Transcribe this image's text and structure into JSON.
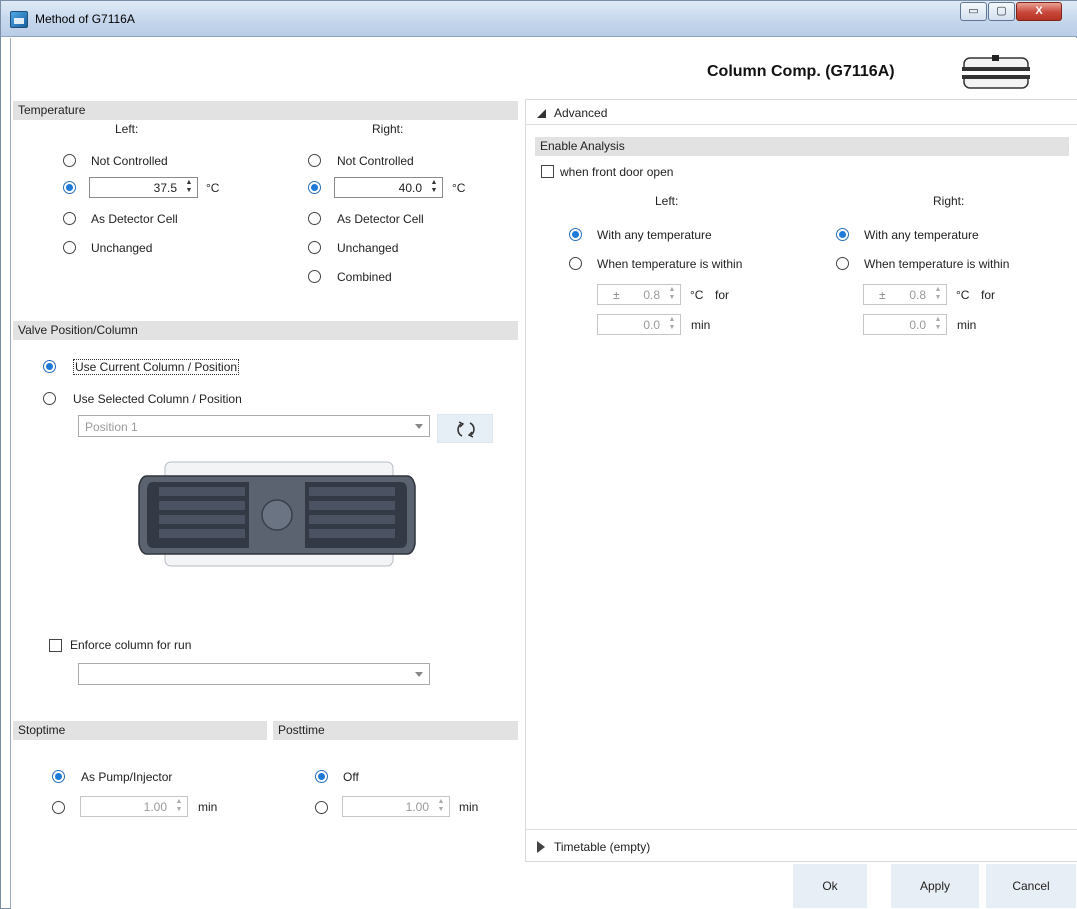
{
  "window": {
    "title": "Method of G7116A",
    "min_glyph": "▭",
    "max_glyph": "▢",
    "close_glyph": "X"
  },
  "header": {
    "device_title": "Column Comp. (G7116A)"
  },
  "temperature": {
    "section_title": "Temperature",
    "left": {
      "heading": "Left:",
      "options": [
        "Not Controlled",
        "As Detector Cell",
        "Unchanged"
      ],
      "value": "37.5",
      "unit": "°C",
      "selected": "setpoint"
    },
    "right": {
      "heading": "Right:",
      "options": [
        "Not Controlled",
        "As Detector Cell",
        "Unchanged",
        "Combined"
      ],
      "value": "40.0",
      "unit": "°C",
      "selected": "setpoint"
    }
  },
  "valve": {
    "section_title": "Valve Position/Column",
    "use_current_label": "Use Current Column / Position",
    "use_selected_label": "Use Selected Column / Position",
    "selected": "use_current",
    "position_select": "Position 1",
    "enforce_label": "Enforce column for run",
    "enforce_checked": false,
    "column_select": ""
  },
  "stoptime": {
    "section_title": "Stoptime",
    "option_label": "As Pump/Injector",
    "value": "1.00",
    "unit": "min",
    "selected": "as_pump"
  },
  "posttime": {
    "section_title": "Posttime",
    "option_label": "Off",
    "value": "1.00",
    "unit": "min",
    "selected": "off"
  },
  "advanced": {
    "header": "Advanced",
    "expanded": true,
    "enable_analysis": {
      "section_title": "Enable Analysis",
      "front_door_label": "when front door open",
      "front_door_checked": false,
      "left": {
        "heading": "Left:",
        "any_label": "With any temperature",
        "within_label": "When temperature is within",
        "selected": "any",
        "pm": "±",
        "tolerance": "0.8",
        "tolerance_unit": "°C",
        "for_label": "for",
        "time": "0.0",
        "time_unit": "min"
      },
      "right": {
        "heading": "Right:",
        "any_label": "With any temperature",
        "within_label": "When temperature is within",
        "selected": "any",
        "pm": "±",
        "tolerance": "0.8",
        "tolerance_unit": "°C",
        "for_label": "for",
        "time": "0.0",
        "time_unit": "min"
      }
    }
  },
  "timetable": {
    "header": "Timetable (empty)",
    "expanded": false
  },
  "footer": {
    "ok_label": "Ok",
    "apply_label": "Apply",
    "cancel_label": "Cancel"
  },
  "colors": {
    "accent": "#1e7ad6",
    "section_bg": "#e2e2e2",
    "button_bg": "#e7eef6"
  }
}
